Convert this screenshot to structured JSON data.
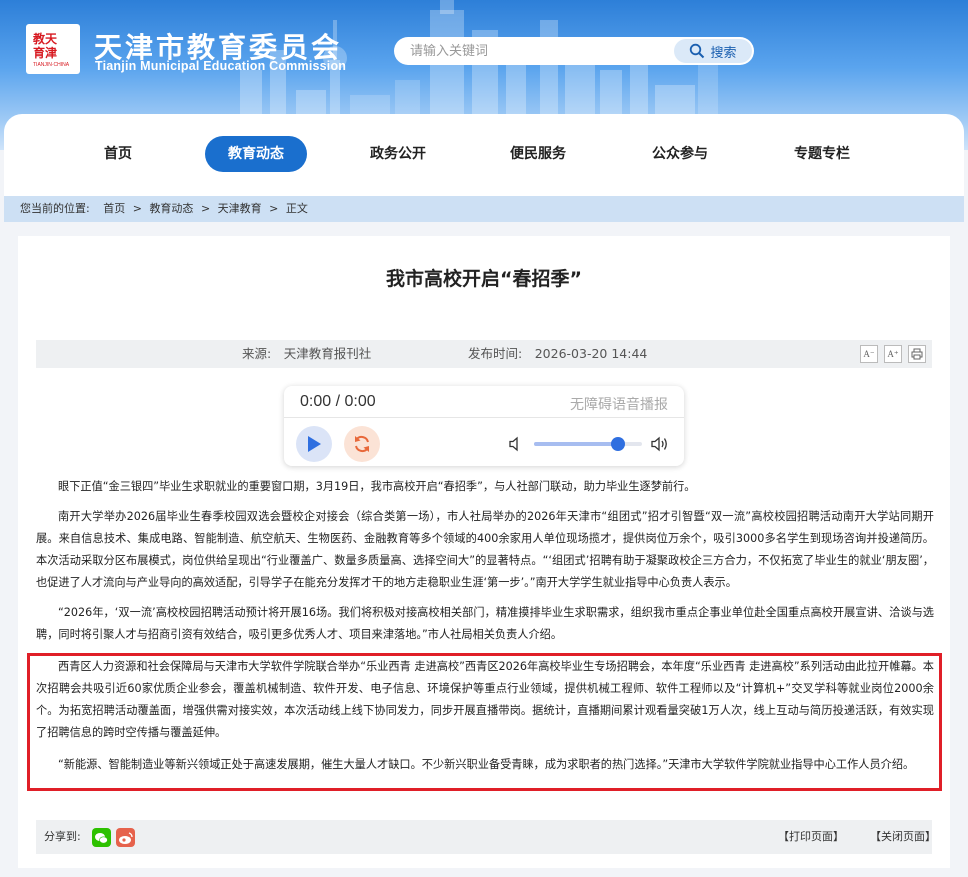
{
  "header": {
    "site_title": "天津市教育委员会",
    "site_subtitle": "Tianjin Municipal Education Commission",
    "logo_text": "教育天津",
    "search_placeholder": "请输入关键词",
    "search_button": "搜索"
  },
  "nav": {
    "items": [
      {
        "label": "首页",
        "active": false
      },
      {
        "label": "教育动态",
        "active": true
      },
      {
        "label": "政务公开",
        "active": false
      },
      {
        "label": "便民服务",
        "active": false
      },
      {
        "label": "公众参与",
        "active": false
      },
      {
        "label": "专题专栏",
        "active": false
      }
    ]
  },
  "breadcrumb": {
    "prefix": "您当前的位置:",
    "items": [
      "首页",
      ">",
      "教育动态",
      ">",
      "天津教育",
      ">",
      "正文"
    ]
  },
  "article": {
    "title": "我市高校开启“春招季”",
    "source": "来源:　天津教育报刊社",
    "publish_time": "发布时间:　2026-03-20 14:44",
    "tools": [
      "A⁻",
      "A⁺",
      "⎙"
    ],
    "paragraphs": [
      "眼下正值“金三银四”毕业生求职就业的重要窗口期，3月19日，我市高校开启“春招季”，与人社部门联动，助力毕业生逐梦前行。",
      "南开大学举办2026届毕业生春季校园双选会暨校企对接会（综合类第一场），市人社局举办的2026年天津市“组团式”招才引智暨“双一流”高校校园招聘活动南开大学站同期开展。来自信息技术、集成电路、智能制造、航空航天、生物医药、金融教育等多个领域的400余家用人单位现场揽才，提供岗位万余个，吸引3000多名学生到现场咨询并投递简历。本次活动采取分区布展模式，岗位供给呈现出“行业覆盖广、数量多质量高、选择空间大”的显著特点。“‘组团式’招聘有助于凝聚政校企三方合力，不仅拓宽了毕业生的就业‘朋友圈’，也促进了人才流向与产业导向的高效适配，引导学子在能充分发挥才干的地方走稳职业生涯‘第一步’。”南开大学学生就业指导中心负责人表示。",
      "“2026年，‘双一流’高校校园招聘活动预计将开展16场。我们将积极对接高校相关部门，精准摸排毕业生求职需求，组织我市重点企事业单位赴全国重点高校开展宣讲、洽谈与选聘，同时将引聚人才与招商引资有效结合，吸引更多优秀人才、项目来津落地。”市人社局相关负责人介绍。",
      "西青区人力资源和社会保障局与天津市大学软件学院联合举办“乐业西青 走进高校”西青区2026年高校毕业生专场招聘会，本年度“乐业西青 走进高校”系列活动由此拉开帷幕。本次招聘会共吸引近60家优质企业参会，覆盖机械制造、软件开发、电子信息、环境保护等重点行业领域，提供机械工程师、软件工程师以及“计算机+”交叉学科等就业岗位2000余个。为拓宽招聘活动覆盖面，增强供需对接实效，本次活动线上线下协同发力，同步开展直播带岗。据统计，直播期间累计观看量突破1万人次，线上互动与简历投递活跃，有效实现了招聘信息的跨时空传播与覆盖延伸。",
      "“新能源、智能制造业等新兴领域正处于高速发展期，催生大量人才缺口。不少新兴职业备受青睐，成为求职者的热门选择。”天津市大学软件学院就业指导中心工作人员介绍。"
    ]
  },
  "player": {
    "time": "0:00 / 0:00",
    "label": "无障碍语音播报",
    "volume": 0.78
  },
  "share": {
    "label": "分享到:",
    "print": "【打印页面】",
    "close": "【关闭页面】"
  },
  "colors": {
    "primary": "#1a6fce",
    "highlight_border": "#e01f28",
    "wechat": "#2dc100",
    "weibo": "#e6624c"
  }
}
